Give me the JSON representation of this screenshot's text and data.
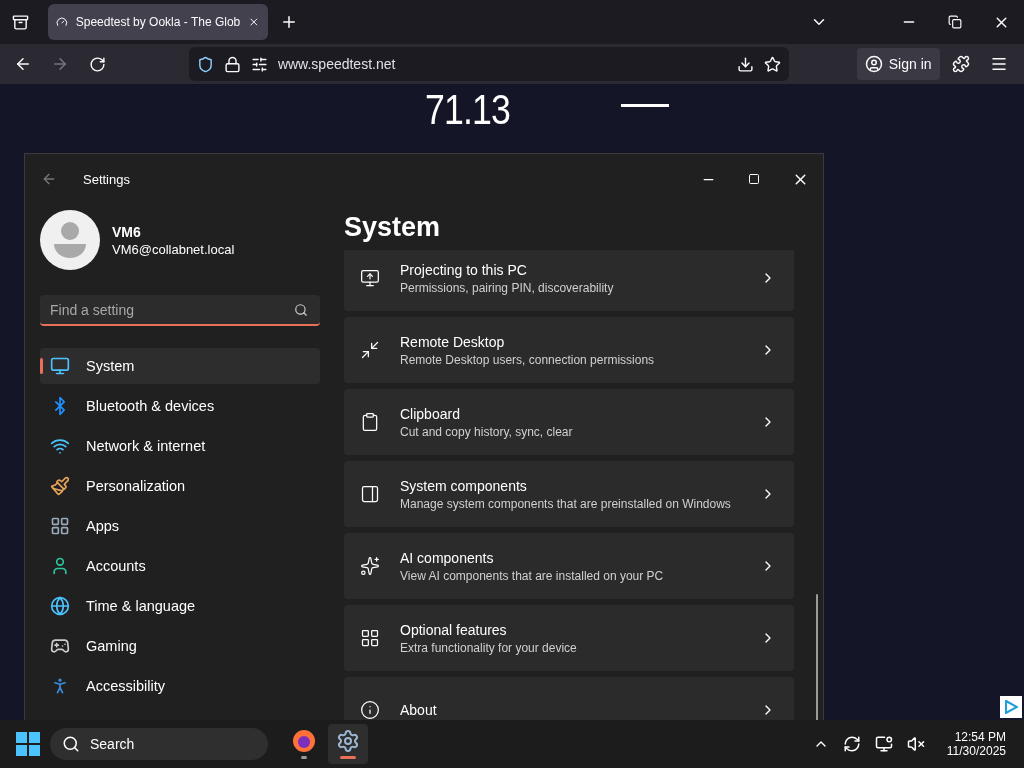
{
  "browser": {
    "tab": {
      "title": "Speedtest by Ookla - The Glob",
      "selected": true
    },
    "url": "www.speedtest.net",
    "sign_in": "Sign in"
  },
  "page": {
    "speed": "71.13"
  },
  "settings": {
    "title": "Settings",
    "user": {
      "name": "VM6",
      "email": "VM6@collabnet.local"
    },
    "search": {
      "placeholder": "Find a setting"
    },
    "nav": [
      {
        "kind": "system",
        "label": "System",
        "selected": true
      },
      {
        "kind": "bluetooth",
        "label": "Bluetooth & devices",
        "selected": false
      },
      {
        "kind": "network",
        "label": "Network & internet",
        "selected": false
      },
      {
        "kind": "personalization",
        "label": "Personalization",
        "selected": false
      },
      {
        "kind": "apps",
        "label": "Apps",
        "selected": false
      },
      {
        "kind": "accounts",
        "label": "Accounts",
        "selected": false
      },
      {
        "kind": "time",
        "label": "Time & language",
        "selected": false
      },
      {
        "kind": "gaming",
        "label": "Gaming",
        "selected": false
      },
      {
        "kind": "accessibility",
        "label": "Accessibility",
        "selected": false
      }
    ],
    "heading": "System",
    "cards": [
      {
        "kind": "projecting",
        "title": "Projecting to this PC",
        "subtitle": "Permissions, pairing PIN, discoverability"
      },
      {
        "kind": "remote",
        "title": "Remote Desktop",
        "subtitle": "Remote Desktop users, connection permissions"
      },
      {
        "kind": "clipboard",
        "title": "Clipboard",
        "subtitle": "Cut and copy history, sync, clear"
      },
      {
        "kind": "components",
        "title": "System components",
        "subtitle": "Manage system components that are preinstalled on Windows"
      },
      {
        "kind": "ai",
        "title": "AI components",
        "subtitle": "View AI components that are installed on your PC"
      },
      {
        "kind": "optional",
        "title": "Optional features",
        "subtitle": "Extra functionality for your device"
      },
      {
        "kind": "about",
        "title": "About"
      }
    ]
  },
  "taskbar": {
    "search": "Search",
    "apps": [
      {
        "kind": "firefox",
        "selected": false
      },
      {
        "kind": "settings",
        "selected": true
      }
    ],
    "time": "12:54 PM",
    "date": "11/30/2025"
  }
}
